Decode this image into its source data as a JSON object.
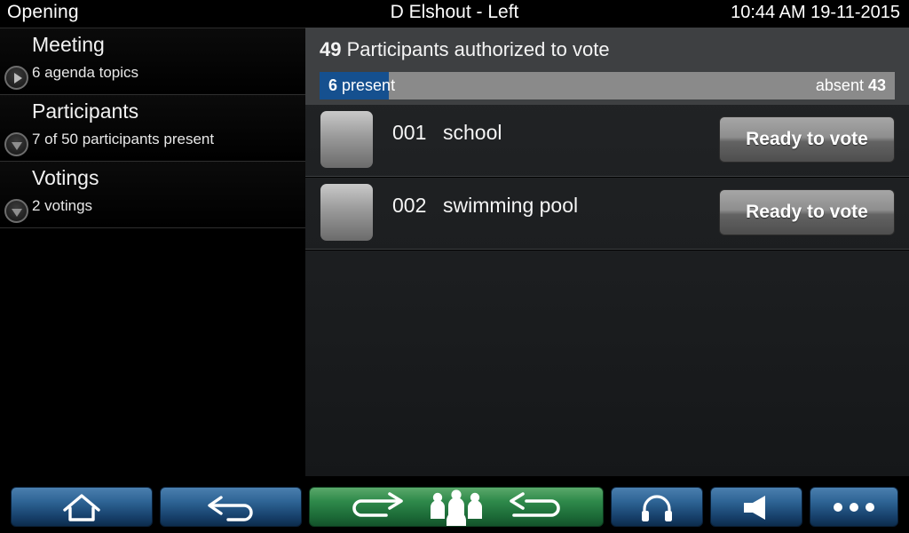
{
  "statusbar": {
    "left": "Opening",
    "center": "D Elshout - Left",
    "right": "10:44 AM 19-11-2015"
  },
  "sidebar": {
    "items": [
      {
        "title": "Meeting",
        "subtitle": "6 agenda topics",
        "toggle": "play-triangle-icon"
      },
      {
        "title": "Participants",
        "subtitle": "7 of 50 participants present",
        "toggle": "chevron-down-icon"
      },
      {
        "title": "Votings",
        "subtitle": "2 votings",
        "toggle": "chevron-down-icon"
      }
    ]
  },
  "main": {
    "header": {
      "count": "49",
      "title": "Participants authorized to vote"
    },
    "progress": {
      "present_count": "6",
      "present_label": "present",
      "absent_label": "absent",
      "absent_count": "43",
      "fill_color": "#15508f",
      "track_color": "#8a8a8a",
      "fill_percent": 12
    },
    "rows": [
      {
        "number": "001",
        "name": "school",
        "button": "Ready to vote",
        "avatar": "participant-thumbnail"
      },
      {
        "number": "002",
        "name": "swimming pool",
        "button": "Ready to vote",
        "avatar": "participant-thumbnail"
      }
    ]
  },
  "toolbar": {
    "buttons": [
      {
        "name": "home-button",
        "icon": "home-icon",
        "style": "blue"
      },
      {
        "name": "back-button",
        "icon": "back-arrow-icon",
        "style": "blue"
      },
      {
        "name": "delegates-button",
        "icon": "delegates-icon",
        "style": "green"
      },
      {
        "name": "headset-button",
        "icon": "headphones-icon",
        "style": "blue"
      },
      {
        "name": "volume-button",
        "icon": "speaker-icon",
        "style": "blue"
      },
      {
        "name": "more-button",
        "icon": "ellipsis-icon",
        "style": "blue"
      }
    ]
  },
  "colors": {
    "accent_blue": "#15508f",
    "toolbar_blue": "#2f6596",
    "toolbar_green": "#2f8a4b",
    "header_band": "#3e4042"
  }
}
